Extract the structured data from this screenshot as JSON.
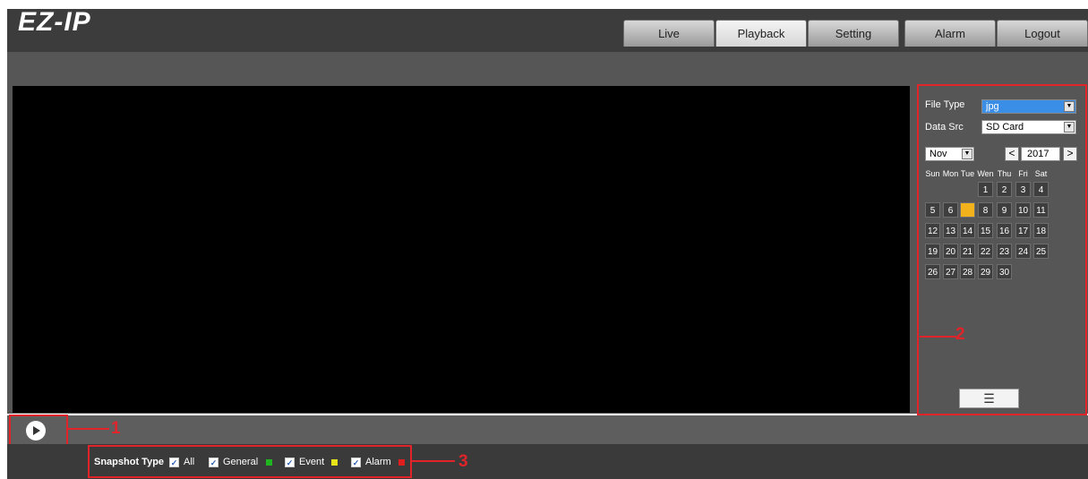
{
  "header": {
    "logo_text": "EZ-IP",
    "tabs": [
      {
        "label": "Live",
        "active": false
      },
      {
        "label": "Playback",
        "active": true
      },
      {
        "label": "Setting",
        "active": false
      },
      {
        "label": "Alarm",
        "active": false
      },
      {
        "label": "Logout",
        "active": false
      }
    ]
  },
  "panel": {
    "file_type_label": "File Type",
    "file_type_value": "jpg",
    "data_src_label": "Data Src",
    "data_src_value": "SD Card",
    "month_value": "Nov",
    "year_value": "2017",
    "prev_year_symbol": "<",
    "next_year_symbol": ">",
    "weekdays": [
      "Sun",
      "Mon",
      "Tue",
      "Wen",
      "Thu",
      "Fri",
      "Sat"
    ],
    "selected_day": 7,
    "days_in_month": 30,
    "first_weekday_index": 3,
    "list_icon": "list-icon"
  },
  "snapshot": {
    "label": "Snapshot Type",
    "options": [
      {
        "label": "All",
        "checked": true,
        "color": null
      },
      {
        "label": "General",
        "checked": true,
        "color": "#1fb51f"
      },
      {
        "label": "Event",
        "checked": true,
        "color": "#e8e41a"
      },
      {
        "label": "Alarm",
        "checked": true,
        "color": "#e01e1e"
      }
    ]
  },
  "annotations": {
    "one": "1",
    "two": "2",
    "three": "3"
  },
  "colors": {
    "header_bg": "#3c3c3c",
    "accent_selected_day": "#f2b21b",
    "annotation_red": "#e0242a"
  }
}
